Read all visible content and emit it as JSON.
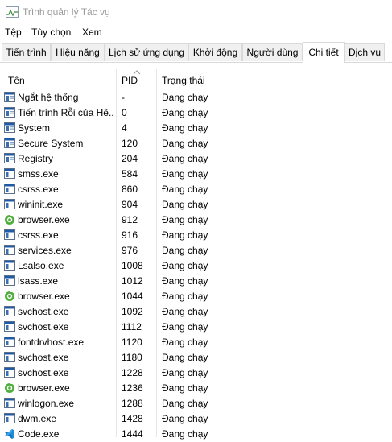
{
  "window": {
    "title": "Trình quản lý Tác vụ"
  },
  "menu": [
    "Tệp",
    "Tùy chọn",
    "Xem"
  ],
  "tabs": [
    "Tiến trình",
    "Hiệu năng",
    "Lịch sử ứng dụng",
    "Khởi động",
    "Người dùng",
    "Chi tiết",
    "Dịch vụ"
  ],
  "active_tab": "Chi tiết",
  "columns": {
    "name": "Tên",
    "pid": "PID",
    "status": "Trạng thái"
  },
  "processes": [
    {
      "name": "Ngắt hệ thống",
      "pid": "-",
      "status": "Đang chạy",
      "icon": "system-process-icon"
    },
    {
      "name": "Tiến trình Rỗi của Hê...",
      "pid": "0",
      "status": "Đang chạy",
      "icon": "system-process-icon"
    },
    {
      "name": "System",
      "pid": "4",
      "status": "Đang chạy",
      "icon": "system-process-icon"
    },
    {
      "name": "Secure System",
      "pid": "120",
      "status": "Đang chạy",
      "icon": "system-process-icon"
    },
    {
      "name": "Registry",
      "pid": "204",
      "status": "Đang chạy",
      "icon": "system-process-icon"
    },
    {
      "name": "smss.exe",
      "pid": "584",
      "status": "Đang chạy",
      "icon": "window-app-icon"
    },
    {
      "name": "csrss.exe",
      "pid": "860",
      "status": "Đang chạy",
      "icon": "window-app-icon"
    },
    {
      "name": "wininit.exe",
      "pid": "904",
      "status": "Đang chạy",
      "icon": "window-app-icon"
    },
    {
      "name": "browser.exe",
      "pid": "912",
      "status": "Đang chạy",
      "icon": "browser-icon"
    },
    {
      "name": "csrss.exe",
      "pid": "916",
      "status": "Đang chạy",
      "icon": "window-app-icon"
    },
    {
      "name": "services.exe",
      "pid": "976",
      "status": "Đang chạy",
      "icon": "window-app-icon"
    },
    {
      "name": "Lsalso.exe",
      "pid": "1008",
      "status": "Đang chạy",
      "icon": "window-app-icon"
    },
    {
      "name": "lsass.exe",
      "pid": "1012",
      "status": "Đang chạy",
      "icon": "window-app-icon"
    },
    {
      "name": "browser.exe",
      "pid": "1044",
      "status": "Đang chạy",
      "icon": "browser-icon"
    },
    {
      "name": "svchost.exe",
      "pid": "1092",
      "status": "Đang chạy",
      "icon": "window-app-icon"
    },
    {
      "name": "svchost.exe",
      "pid": "1112",
      "status": "Đang chạy",
      "icon": "window-app-icon"
    },
    {
      "name": "fontdrvhost.exe",
      "pid": "1120",
      "status": "Đang chạy",
      "icon": "window-app-icon"
    },
    {
      "name": "svchost.exe",
      "pid": "1180",
      "status": "Đang chạy",
      "icon": "window-app-icon"
    },
    {
      "name": "svchost.exe",
      "pid": "1228",
      "status": "Đang chạy",
      "icon": "window-app-icon"
    },
    {
      "name": "browser.exe",
      "pid": "1236",
      "status": "Đang chạy",
      "icon": "browser-icon"
    },
    {
      "name": "winlogon.exe",
      "pid": "1288",
      "status": "Đang chạy",
      "icon": "window-app-icon"
    },
    {
      "name": "dwm.exe",
      "pid": "1428",
      "status": "Đang chạy",
      "icon": "window-app-icon"
    },
    {
      "name": "Code.exe",
      "pid": "1444",
      "status": "Đang chạy",
      "icon": "vscode-icon"
    }
  ],
  "colors": {
    "accent_blue": "#1e5aa8",
    "browser_green": "#4fae3c",
    "vscode_blue": "#1f8ad6",
    "tab_border": "#d9d9d9"
  }
}
